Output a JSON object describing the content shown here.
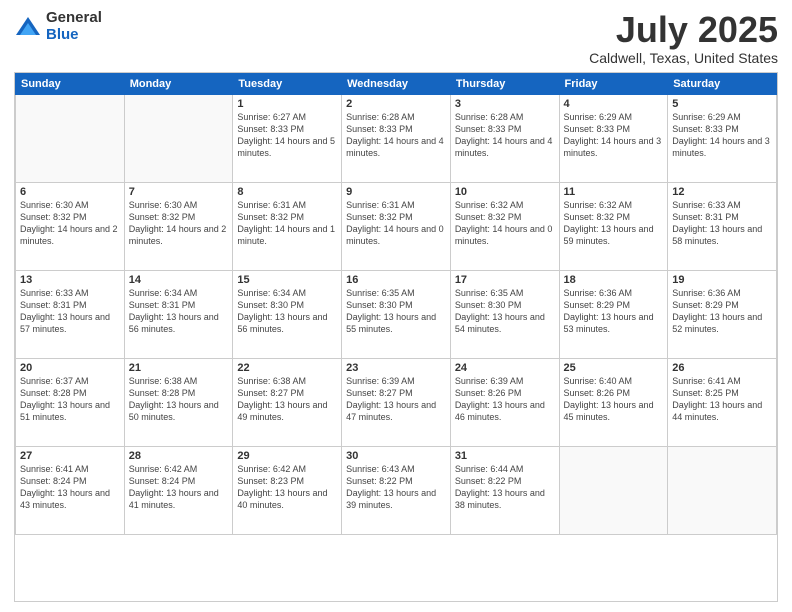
{
  "logo": {
    "general": "General",
    "blue": "Blue"
  },
  "title": {
    "month": "July 2025",
    "location": "Caldwell, Texas, United States"
  },
  "weekdays": [
    "Sunday",
    "Monday",
    "Tuesday",
    "Wednesday",
    "Thursday",
    "Friday",
    "Saturday"
  ],
  "weeks": [
    [
      {
        "day": null
      },
      {
        "day": null
      },
      {
        "day": "1",
        "sunrise": "Sunrise: 6:27 AM",
        "sunset": "Sunset: 8:33 PM",
        "daylight": "Daylight: 14 hours and 5 minutes."
      },
      {
        "day": "2",
        "sunrise": "Sunrise: 6:28 AM",
        "sunset": "Sunset: 8:33 PM",
        "daylight": "Daylight: 14 hours and 4 minutes."
      },
      {
        "day": "3",
        "sunrise": "Sunrise: 6:28 AM",
        "sunset": "Sunset: 8:33 PM",
        "daylight": "Daylight: 14 hours and 4 minutes."
      },
      {
        "day": "4",
        "sunrise": "Sunrise: 6:29 AM",
        "sunset": "Sunset: 8:33 PM",
        "daylight": "Daylight: 14 hours and 3 minutes."
      },
      {
        "day": "5",
        "sunrise": "Sunrise: 6:29 AM",
        "sunset": "Sunset: 8:33 PM",
        "daylight": "Daylight: 14 hours and 3 minutes."
      }
    ],
    [
      {
        "day": "6",
        "sunrise": "Sunrise: 6:30 AM",
        "sunset": "Sunset: 8:32 PM",
        "daylight": "Daylight: 14 hours and 2 minutes."
      },
      {
        "day": "7",
        "sunrise": "Sunrise: 6:30 AM",
        "sunset": "Sunset: 8:32 PM",
        "daylight": "Daylight: 14 hours and 2 minutes."
      },
      {
        "day": "8",
        "sunrise": "Sunrise: 6:31 AM",
        "sunset": "Sunset: 8:32 PM",
        "daylight": "Daylight: 14 hours and 1 minute."
      },
      {
        "day": "9",
        "sunrise": "Sunrise: 6:31 AM",
        "sunset": "Sunset: 8:32 PM",
        "daylight": "Daylight: 14 hours and 0 minutes."
      },
      {
        "day": "10",
        "sunrise": "Sunrise: 6:32 AM",
        "sunset": "Sunset: 8:32 PM",
        "daylight": "Daylight: 14 hours and 0 minutes."
      },
      {
        "day": "11",
        "sunrise": "Sunrise: 6:32 AM",
        "sunset": "Sunset: 8:32 PM",
        "daylight": "Daylight: 13 hours and 59 minutes."
      },
      {
        "day": "12",
        "sunrise": "Sunrise: 6:33 AM",
        "sunset": "Sunset: 8:31 PM",
        "daylight": "Daylight: 13 hours and 58 minutes."
      }
    ],
    [
      {
        "day": "13",
        "sunrise": "Sunrise: 6:33 AM",
        "sunset": "Sunset: 8:31 PM",
        "daylight": "Daylight: 13 hours and 57 minutes."
      },
      {
        "day": "14",
        "sunrise": "Sunrise: 6:34 AM",
        "sunset": "Sunset: 8:31 PM",
        "daylight": "Daylight: 13 hours and 56 minutes."
      },
      {
        "day": "15",
        "sunrise": "Sunrise: 6:34 AM",
        "sunset": "Sunset: 8:30 PM",
        "daylight": "Daylight: 13 hours and 56 minutes."
      },
      {
        "day": "16",
        "sunrise": "Sunrise: 6:35 AM",
        "sunset": "Sunset: 8:30 PM",
        "daylight": "Daylight: 13 hours and 55 minutes."
      },
      {
        "day": "17",
        "sunrise": "Sunrise: 6:35 AM",
        "sunset": "Sunset: 8:30 PM",
        "daylight": "Daylight: 13 hours and 54 minutes."
      },
      {
        "day": "18",
        "sunrise": "Sunrise: 6:36 AM",
        "sunset": "Sunset: 8:29 PM",
        "daylight": "Daylight: 13 hours and 53 minutes."
      },
      {
        "day": "19",
        "sunrise": "Sunrise: 6:36 AM",
        "sunset": "Sunset: 8:29 PM",
        "daylight": "Daylight: 13 hours and 52 minutes."
      }
    ],
    [
      {
        "day": "20",
        "sunrise": "Sunrise: 6:37 AM",
        "sunset": "Sunset: 8:28 PM",
        "daylight": "Daylight: 13 hours and 51 minutes."
      },
      {
        "day": "21",
        "sunrise": "Sunrise: 6:38 AM",
        "sunset": "Sunset: 8:28 PM",
        "daylight": "Daylight: 13 hours and 50 minutes."
      },
      {
        "day": "22",
        "sunrise": "Sunrise: 6:38 AM",
        "sunset": "Sunset: 8:27 PM",
        "daylight": "Daylight: 13 hours and 49 minutes."
      },
      {
        "day": "23",
        "sunrise": "Sunrise: 6:39 AM",
        "sunset": "Sunset: 8:27 PM",
        "daylight": "Daylight: 13 hours and 47 minutes."
      },
      {
        "day": "24",
        "sunrise": "Sunrise: 6:39 AM",
        "sunset": "Sunset: 8:26 PM",
        "daylight": "Daylight: 13 hours and 46 minutes."
      },
      {
        "day": "25",
        "sunrise": "Sunrise: 6:40 AM",
        "sunset": "Sunset: 8:26 PM",
        "daylight": "Daylight: 13 hours and 45 minutes."
      },
      {
        "day": "26",
        "sunrise": "Sunrise: 6:41 AM",
        "sunset": "Sunset: 8:25 PM",
        "daylight": "Daylight: 13 hours and 44 minutes."
      }
    ],
    [
      {
        "day": "27",
        "sunrise": "Sunrise: 6:41 AM",
        "sunset": "Sunset: 8:24 PM",
        "daylight": "Daylight: 13 hours and 43 minutes."
      },
      {
        "day": "28",
        "sunrise": "Sunrise: 6:42 AM",
        "sunset": "Sunset: 8:24 PM",
        "daylight": "Daylight: 13 hours and 41 minutes."
      },
      {
        "day": "29",
        "sunrise": "Sunrise: 6:42 AM",
        "sunset": "Sunset: 8:23 PM",
        "daylight": "Daylight: 13 hours and 40 minutes."
      },
      {
        "day": "30",
        "sunrise": "Sunrise: 6:43 AM",
        "sunset": "Sunset: 8:22 PM",
        "daylight": "Daylight: 13 hours and 39 minutes."
      },
      {
        "day": "31",
        "sunrise": "Sunrise: 6:44 AM",
        "sunset": "Sunset: 8:22 PM",
        "daylight": "Daylight: 13 hours and 38 minutes."
      },
      {
        "day": null
      },
      {
        "day": null
      }
    ]
  ]
}
